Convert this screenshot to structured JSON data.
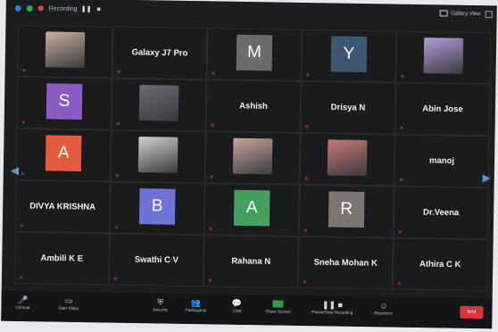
{
  "topbar": {
    "recording_label": "Recording",
    "view_label": "Gallery View"
  },
  "tiles": [
    {
      "kind": "photo",
      "photo_color": "#c7b0a2",
      "caption": "",
      "muted": true
    },
    {
      "kind": "name",
      "name": "Galaxy J7 Pro",
      "caption": "",
      "muted": true
    },
    {
      "kind": "avatar",
      "letter": "M",
      "color": "#6c6b6a",
      "caption": "",
      "muted": true
    },
    {
      "kind": "avatar",
      "letter": "Y",
      "color": "#3f5670",
      "caption": "",
      "muted": true
    },
    {
      "kind": "photo",
      "photo_color": "#b69ad9",
      "caption": "",
      "muted": true
    },
    {
      "kind": "avatar",
      "letter": "S",
      "color": "#8b5bc4",
      "caption": "",
      "muted": true
    },
    {
      "kind": "photo",
      "photo_color": "#6c6b76",
      "caption": "",
      "muted": true
    },
    {
      "kind": "name",
      "name": "Ashish",
      "caption": "",
      "muted": true
    },
    {
      "kind": "name",
      "name": "Drisya N",
      "caption": "",
      "muted": true
    },
    {
      "kind": "name",
      "name": "Abin Jose",
      "caption": "",
      "muted": true
    },
    {
      "kind": "avatar",
      "letter": "A",
      "color": "#e45a3c",
      "caption": "",
      "muted": true
    },
    {
      "kind": "photo",
      "photo_color": "#d2d2d2",
      "caption": "",
      "muted": true
    },
    {
      "kind": "photo",
      "photo_color": "#c9a79a",
      "caption": "",
      "muted": true
    },
    {
      "kind": "photo",
      "photo_color": "#c77a78",
      "caption": "",
      "muted": true
    },
    {
      "kind": "name",
      "name": "manoj",
      "caption": "",
      "muted": true
    },
    {
      "kind": "name",
      "name": "DIVYA KRISHNA",
      "caption": "",
      "muted": true
    },
    {
      "kind": "avatar",
      "letter": "B",
      "color": "#6d73d9",
      "caption": "",
      "muted": true
    },
    {
      "kind": "avatar",
      "letter": "A",
      "color": "#43a05f",
      "caption": "",
      "muted": true
    },
    {
      "kind": "avatar",
      "letter": "R",
      "color": "#7c7572",
      "caption": "",
      "muted": true
    },
    {
      "kind": "name",
      "name": "Dr.Veena",
      "caption": "",
      "muted": true
    },
    {
      "kind": "name",
      "name": "Ambili K E",
      "caption": "",
      "muted": true
    },
    {
      "kind": "name",
      "name": "Swathi C V",
      "caption": "",
      "muted": true
    },
    {
      "kind": "name",
      "name": "Rahana N",
      "caption": "",
      "muted": true
    },
    {
      "kind": "name",
      "name": "Sneha Mohan K",
      "caption": "",
      "muted": true
    },
    {
      "kind": "name",
      "name": "Athira C K",
      "caption": "",
      "muted": true
    }
  ],
  "toolbar": {
    "unmute": "Unmute",
    "start_video": "Start Video",
    "security": "Security",
    "participants": "Participants",
    "chat": "Chat",
    "share_screen": "Share Screen",
    "recording": "Pause/Stop Recording",
    "reactions": "Reactions",
    "end": "End"
  }
}
